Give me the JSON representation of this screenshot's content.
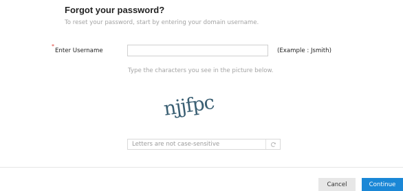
{
  "page": {
    "title": "Forgot your password?",
    "subtitle": "To reset your password, start by entering your domain username."
  },
  "form": {
    "required_marker": "*",
    "username_label": "Enter Username",
    "username_value": "",
    "username_example": "(Example : Jsmith)",
    "captcha_hint": "Type the characters you see in the picture below.",
    "captcha_text": "njjfpc",
    "captcha_placeholder": "Letters are not case-sensitive",
    "refresh_icon": "refresh-icon"
  },
  "actions": {
    "cancel_label": "Cancel",
    "continue_label": "Continue"
  },
  "colors": {
    "accent": "#1a87d6",
    "required": "#e0433a",
    "captcha_text": "#3a5f73"
  }
}
